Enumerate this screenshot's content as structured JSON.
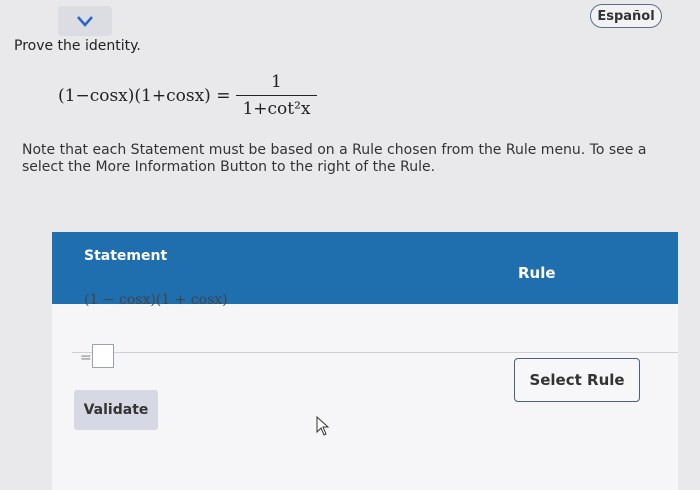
{
  "header": {
    "collapse_icon": "chevron-down-icon",
    "language_button": "Español"
  },
  "question": {
    "prompt": "Prove the identity.",
    "identity_lhs": "(1−cosx)(1+cosx) =",
    "identity_rhs_numerator": "1",
    "identity_rhs_denominator": "1+cot²x",
    "note": "Note that each Statement must be based on a Rule chosen from the Rule menu. To see a",
    "note_line2": "select the More Information Button to the right of the Rule."
  },
  "proof": {
    "statement_header": "Statement",
    "rule_header": "Rule",
    "given_statement": "(1 − cosx)(1 + cosx)",
    "equals_sign": "=",
    "select_rule_button": "Select Rule",
    "validate_button": "Validate"
  },
  "colors": {
    "header_blue": "#1f6fae",
    "background": "#e9e9ec"
  }
}
